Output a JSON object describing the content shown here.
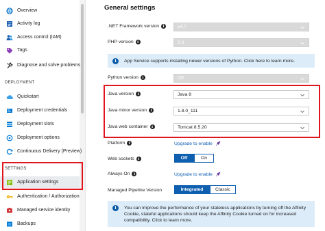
{
  "sidebar": {
    "items": [
      {
        "label": "Overview",
        "icon": "globe-icon",
        "color": "#0078d4"
      },
      {
        "label": "Activity log",
        "icon": "activity-log-icon",
        "color": "#1a5fb4"
      },
      {
        "label": "Access control (IAM)",
        "icon": "people-icon",
        "color": "#1a5fb4"
      },
      {
        "label": "Tags",
        "icon": "tag-icon",
        "color": "#8a3fb8"
      },
      {
        "label": "Diagnose and solve problems",
        "icon": "wrench-icon",
        "color": "#333333"
      }
    ],
    "deployment_title": "DEPLOYMENT",
    "deployment_items": [
      {
        "label": "Quickstart",
        "icon": "cloud-icon",
        "color": "#0078d4"
      },
      {
        "label": "Deployment credentials",
        "icon": "credentials-icon",
        "color": "#0078d4"
      },
      {
        "label": "Deployment slots",
        "icon": "slots-icon",
        "color": "#0078d4"
      },
      {
        "label": "Deployment options",
        "icon": "options-icon",
        "color": "#0078d4"
      },
      {
        "label": "Continuous Delivery (Preview)",
        "icon": "cycle-icon",
        "color": "#0078d4"
      }
    ],
    "settings_title": "SETTINGS",
    "settings_items": [
      {
        "label": "Application settings",
        "icon": "settings-list-icon",
        "color": "#7fba00",
        "active": true
      },
      {
        "label": "Authentication / Authorization",
        "icon": "key-icon",
        "color": "#f2a900"
      },
      {
        "label": "Managed service identity",
        "icon": "identity-icon",
        "color": "#d13438"
      },
      {
        "label": "Backups",
        "icon": "backup-icon",
        "color": "#0078d4"
      }
    ]
  },
  "main": {
    "title": "General settings",
    "net_framework": {
      "label": ".NET Framework version",
      "value": "v4.7"
    },
    "php": {
      "label": "PHP version",
      "value": "5.6"
    },
    "python_banner": "App Service supports installing newer versions of Python. Click here to learn more.",
    "python": {
      "label": "Python version",
      "value": "Off"
    },
    "java_version": {
      "label": "Java version",
      "value": "Java 8"
    },
    "java_minor": {
      "label": "Java minor version",
      "value": "1.8.0_111"
    },
    "java_container": {
      "label": "Java web container",
      "value": "Tomcat 8.5.20"
    },
    "platform": {
      "label": "Platform",
      "link": "Upgrade to enable"
    },
    "web_sockets": {
      "label": "Web sockets",
      "off": "Off",
      "on": "On"
    },
    "always_on": {
      "label": "Always On",
      "link": "Upgrade to enable"
    },
    "pipeline": {
      "label": "Managed Pipeline Version",
      "integrated": "Integrated",
      "classic": "Classic"
    },
    "affinity_banner": "You can improve the performance of your stateless applications by turning off the Affinity Cookie, stateful applications should keep the Affinity Cookie turned on for increased compatibility. Click to learn more."
  },
  "colors": {
    "accent": "#0f5fb0",
    "highlight": "#e0161e",
    "banner": "#dcecf9"
  }
}
